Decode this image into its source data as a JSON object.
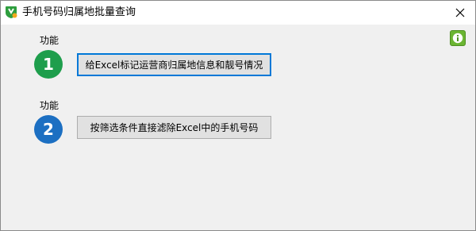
{
  "window": {
    "title": "手机号码归属地批量查询"
  },
  "features": [
    {
      "label": "功能",
      "number": "1",
      "button_label": "给Excel标记运营商归属地信息和靓号情况",
      "color": "#1e9e4c"
    },
    {
      "label": "功能",
      "number": "2",
      "button_label": "按筛选条件直接滤除Excel中的手机号码",
      "color": "#1c6fc2"
    }
  ],
  "icons": {
    "app": "app-logo-icon",
    "close": "close-icon",
    "info": "info-icon"
  }
}
